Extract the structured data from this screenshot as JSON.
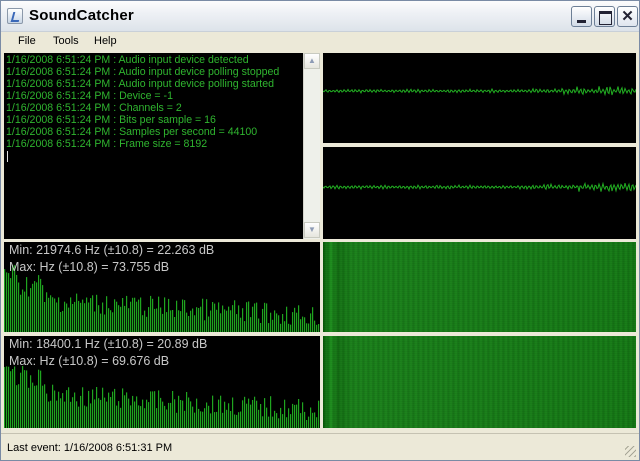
{
  "window": {
    "title": "SoundCatcher"
  },
  "menu": {
    "items": [
      "File",
      "Tools",
      "Help"
    ]
  },
  "log": {
    "lines": [
      "1/16/2008 6:51:24 PM : Audio input device detected",
      "1/16/2008 6:51:24 PM : Audio input device polling stopped",
      "1/16/2008 6:51:24 PM : Audio input device polling started",
      "1/16/2008 6:51:24 PM : Device = -1",
      "1/16/2008 6:51:24 PM : Channels = 2",
      "1/16/2008 6:51:24 PM : Bits per sample = 16",
      "1/16/2008 6:51:24 PM : Samples per second = 44100",
      "1/16/2008 6:51:24 PM : Frame size = 8192"
    ],
    "text_color": "#2fb52f"
  },
  "spectrum": {
    "top": {
      "min_line": "Min: 21974.6 Hz (±10.8) = 22.263 dB",
      "max_line": "Max:  Hz (±10.8) = 73.755 dB"
    },
    "bottom": {
      "min_line": "Min: 18400.1 Hz (±10.8) = 20.89 dB",
      "max_line": "Max:  Hz (±10.8) = 69.676 dB"
    },
    "bar_color": "#1fa51f"
  },
  "waveform": {
    "color": "#22b022"
  },
  "spectrogram": {
    "color": "#1a7f1a"
  },
  "status": {
    "last_event": "Last event:  1/16/2008 6:51:31 PM"
  },
  "icons": {
    "app": "app-icon",
    "minimize": "minimize-icon",
    "maximize": "maximize-icon",
    "close": "close-icon"
  }
}
